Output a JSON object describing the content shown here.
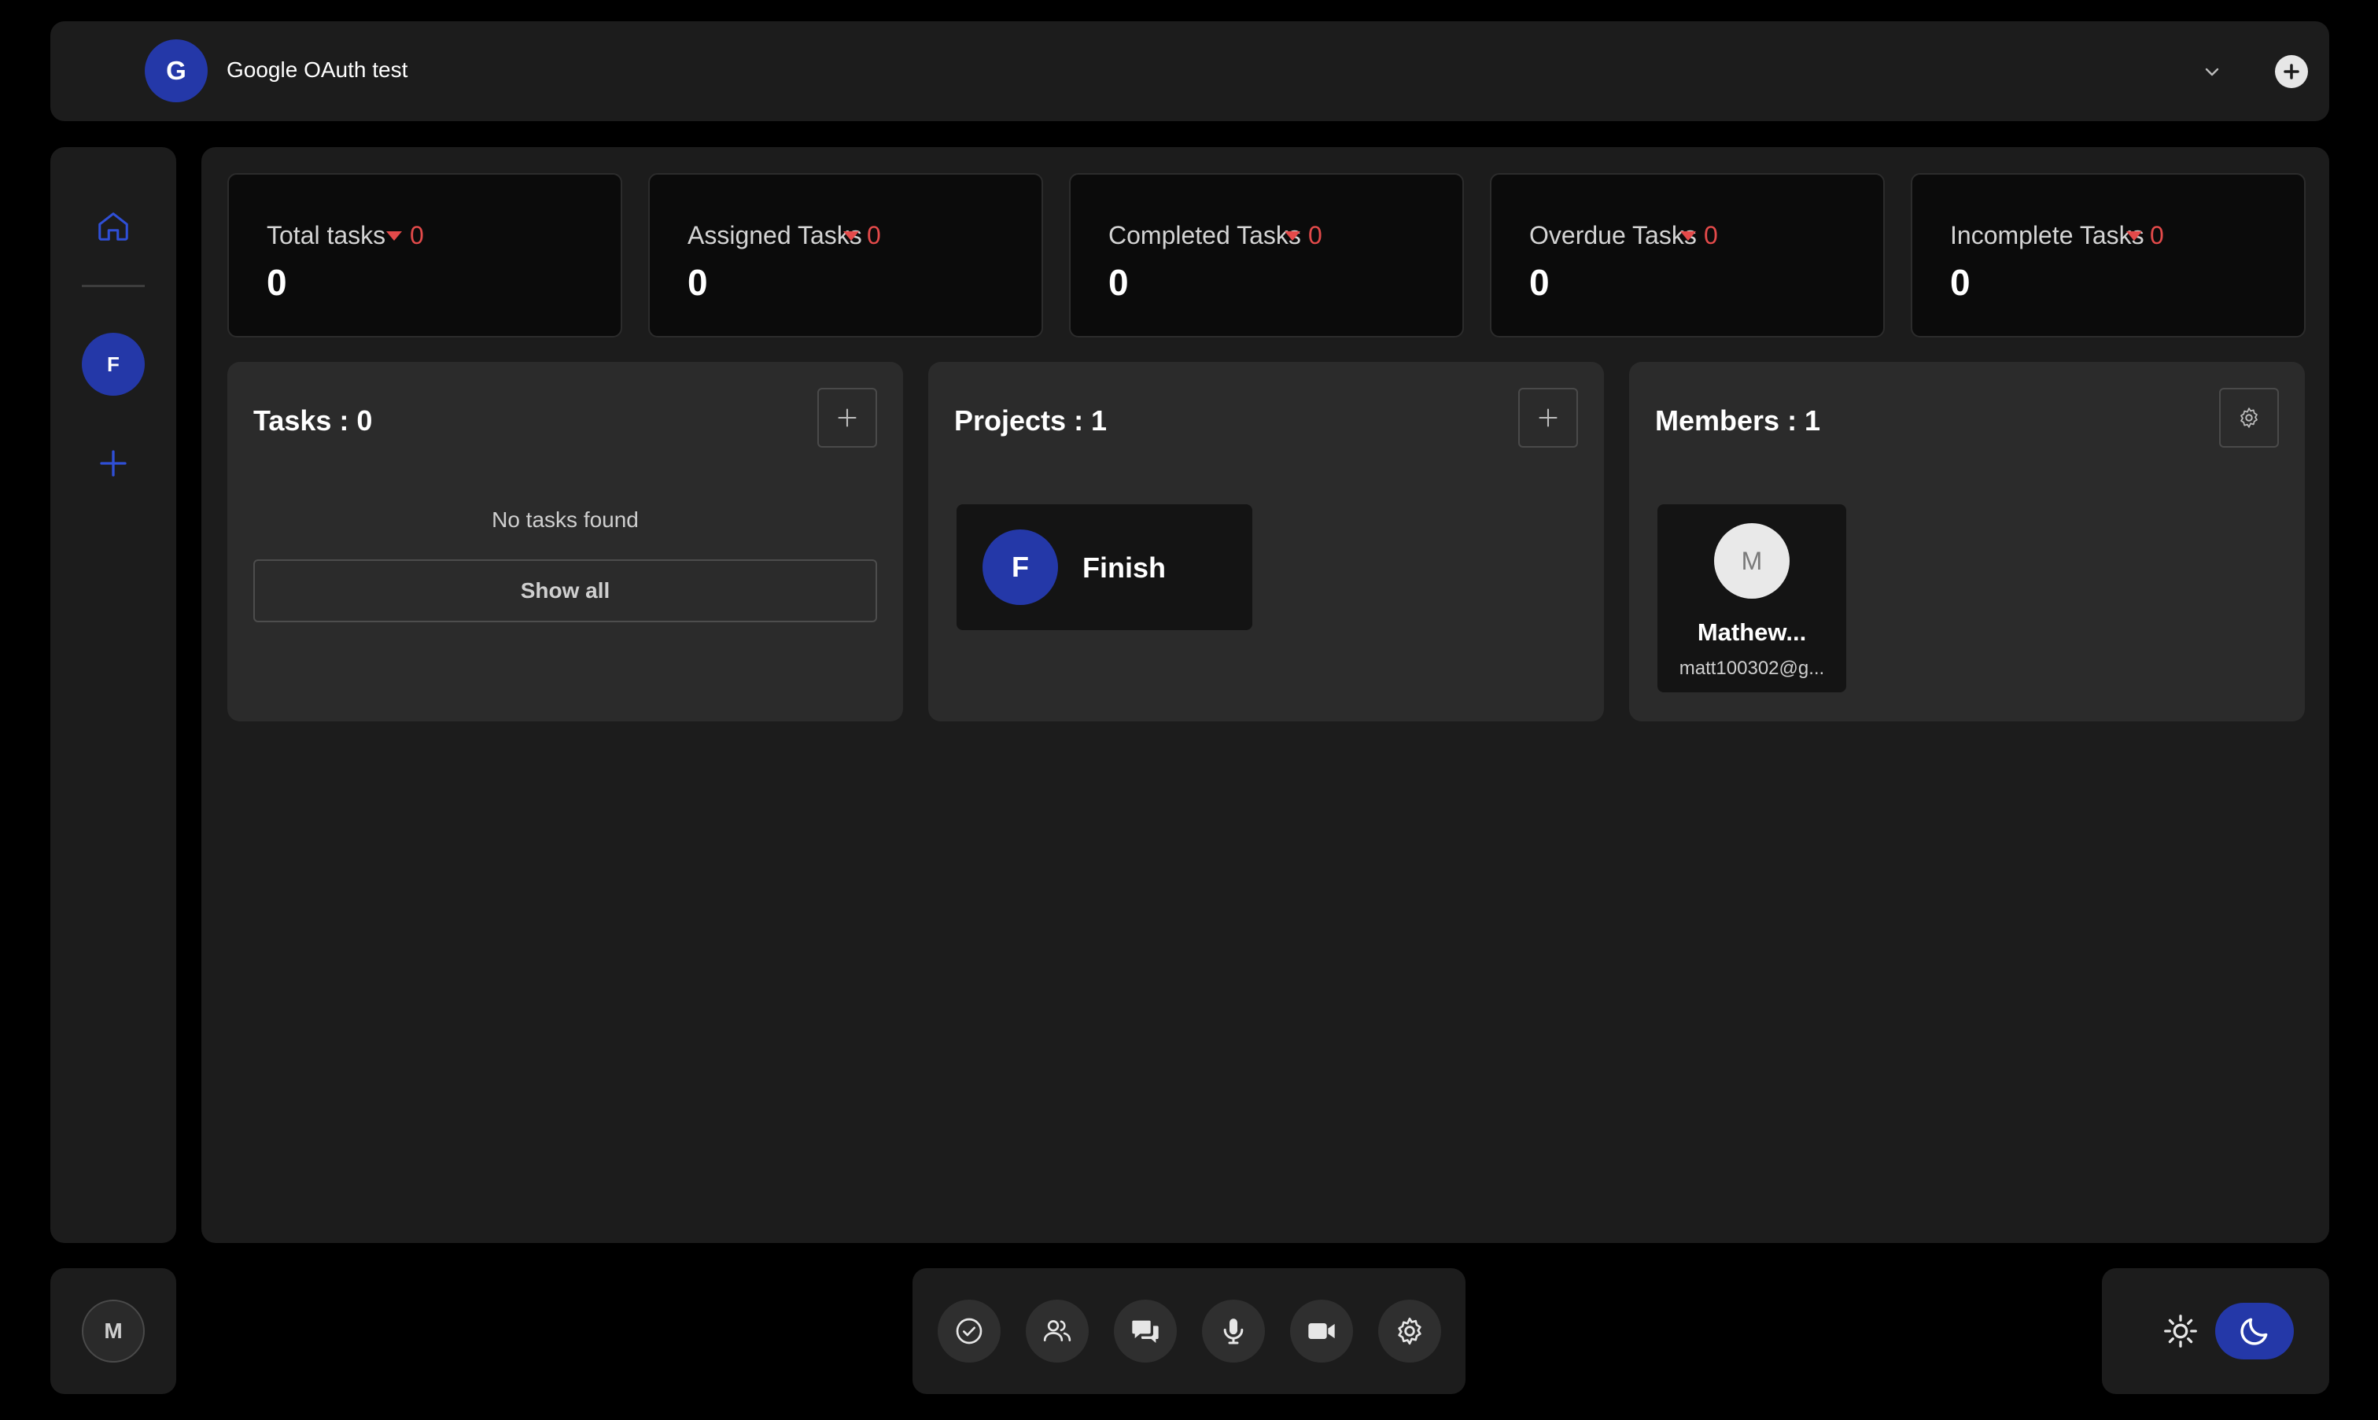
{
  "header": {
    "workspace_initial": "G",
    "workspace_name": "Google OAuth test"
  },
  "sidebar": {
    "project_initial": "F"
  },
  "stats": [
    {
      "title": "Total tasks",
      "delta": "0",
      "value": "0"
    },
    {
      "title": "Assigned Tasks",
      "delta": "0",
      "value": "0"
    },
    {
      "title": "Completed Tasks",
      "delta": "0",
      "value": "0"
    },
    {
      "title": "Overdue Tasks",
      "delta": "0",
      "value": "0"
    },
    {
      "title": "Incomplete Tasks",
      "delta": "0",
      "value": "0"
    }
  ],
  "tasks_card": {
    "title": "Tasks : 0",
    "empty_text": "No tasks found",
    "show_all_label": "Show all"
  },
  "projects_card": {
    "title": "Projects : 1",
    "projects": [
      {
        "initial": "F",
        "name": "Finish"
      }
    ]
  },
  "members_card": {
    "title": "Members : 1",
    "members": [
      {
        "initial": "M",
        "name": "Mathew...",
        "email": "matt100302@g..."
      }
    ]
  },
  "user": {
    "initial": "M"
  },
  "toolbar": {
    "icons": [
      "tasks-check-icon",
      "members-icon",
      "chat-icon",
      "microphone-icon",
      "video-camera-icon",
      "settings-gear-icon"
    ]
  },
  "theme": {
    "active": "dark"
  },
  "colors": {
    "accent": "#2438a8",
    "delta_negative": "#e34a4a",
    "background": "#000000",
    "panel": "#1c1c1c",
    "card": "#2b2b2b"
  }
}
